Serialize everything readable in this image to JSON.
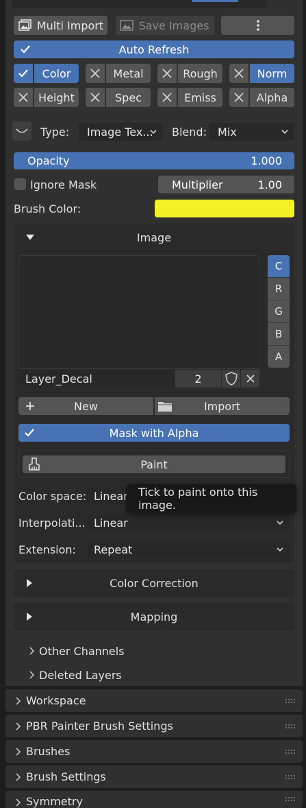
{
  "toolbar": {
    "multi_import": "Multi Import",
    "save_images": "Save Images"
  },
  "auto_refresh": "Auto Refresh",
  "channels": [
    {
      "label": "Color",
      "checked": true
    },
    {
      "label": "Metal",
      "checked": false
    },
    {
      "label": "Rough",
      "checked": false
    },
    {
      "label": "Norm",
      "checked": false
    },
    {
      "label": "Height",
      "checked": false
    },
    {
      "label": "Spec",
      "checked": false
    },
    {
      "label": "Emiss",
      "checked": false
    },
    {
      "label": "Alpha",
      "checked": false
    }
  ],
  "type": {
    "label": "Type:",
    "value": "Image Tex..."
  },
  "blend": {
    "label": "Blend:",
    "value": "Mix"
  },
  "opacity": {
    "label": "Opacity",
    "value": "1.000",
    "fill_fraction": 1.0
  },
  "ignore_mask": {
    "label": "Ignore Mask",
    "checked": false
  },
  "multiplier": {
    "label": "Multiplier",
    "value": "1.00"
  },
  "brush_color": {
    "label": "Brush Color:",
    "color": "#f2f227"
  },
  "image_panel": {
    "title": "Image",
    "channel_buttons": [
      "C",
      "R",
      "G",
      "B",
      "A"
    ],
    "active_channel": "C",
    "image_name": "Layer_Decal",
    "users": "2",
    "new_label": "New",
    "import_label": "Import",
    "mask_with_alpha": "Mask with Alpha",
    "paint_label": "Paint",
    "color_space": {
      "label": "Color space:",
      "value": "Linear"
    },
    "interpolation": {
      "label": "Interpolati...",
      "value": "Linear"
    },
    "extension": {
      "label": "Extension:",
      "value": "Repeat"
    }
  },
  "tooltip": "Tick to paint onto this image.",
  "subpanels": {
    "color_correction": "Color Correction",
    "mapping": "Mapping"
  },
  "tree_items": [
    "Other Channels",
    "Deleted Layers"
  ],
  "sections": [
    "Workspace",
    "PBR Painter Brush Settings",
    "Brushes",
    "Brush Settings",
    "Symmetry"
  ],
  "colors": {
    "accent": "#4772b3",
    "panel": "#303030",
    "background": "#1d1d1d",
    "button": "#545454"
  }
}
